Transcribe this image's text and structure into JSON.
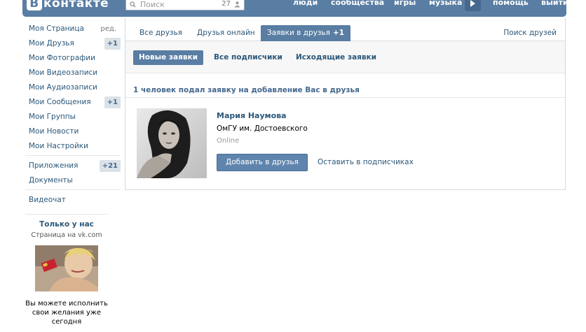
{
  "header": {
    "logo_letter": "В",
    "logo_text": "контакте",
    "search_placeholder": "Поиск",
    "search_count": "27",
    "nav": [
      "люди",
      "сообщества",
      "игры",
      "музыка",
      "помощь",
      "выйти"
    ]
  },
  "sidebar": {
    "edit_label": "ред.",
    "items": [
      {
        "label": "Моя Страница"
      },
      {
        "label": "Мои Друзья",
        "badge": "+1"
      },
      {
        "label": "Мои Фотографии"
      },
      {
        "label": "Мои Видеозаписи"
      },
      {
        "label": "Мои Аудиозаписи"
      },
      {
        "label": "Мои Сообщения",
        "badge": "+1"
      },
      {
        "label": "Мои Группы"
      },
      {
        "label": "Мои Новости"
      },
      {
        "label": "Мои Настройки"
      },
      {
        "label": "Приложения",
        "badge": "+21"
      },
      {
        "label": "Документы"
      },
      {
        "label": "Видеочат"
      }
    ],
    "promo": {
      "title": "Только у нас",
      "subtitle": "Страница на vk.com",
      "text": "Вы можете исполнить свои желания уже сегодня"
    }
  },
  "main": {
    "tabs": [
      {
        "label": "Все друзья"
      },
      {
        "label": "Друзья онлайн"
      },
      {
        "label": "Заявки в друзья",
        "badge": "+1",
        "active": true
      }
    ],
    "find_friends": "Поиск друзей",
    "subtabs": [
      {
        "label": "Новые заявки",
        "active": true
      },
      {
        "label": "Все подписчики"
      },
      {
        "label": "Исходящие заявки"
      }
    ],
    "summary": "1 человек подал заявку на добавление Вас в друзья",
    "request": {
      "name": "Мария Наумова",
      "school": "ОмГУ им. Достоевского",
      "status": "Online",
      "add_button": "Добавить в друзья",
      "keep_link": "Оставить в подписчиках"
    }
  },
  "colors": {
    "header_blue": "#597da3",
    "link_blue": "#2b587a",
    "badge_bg": "#dae2e8"
  }
}
